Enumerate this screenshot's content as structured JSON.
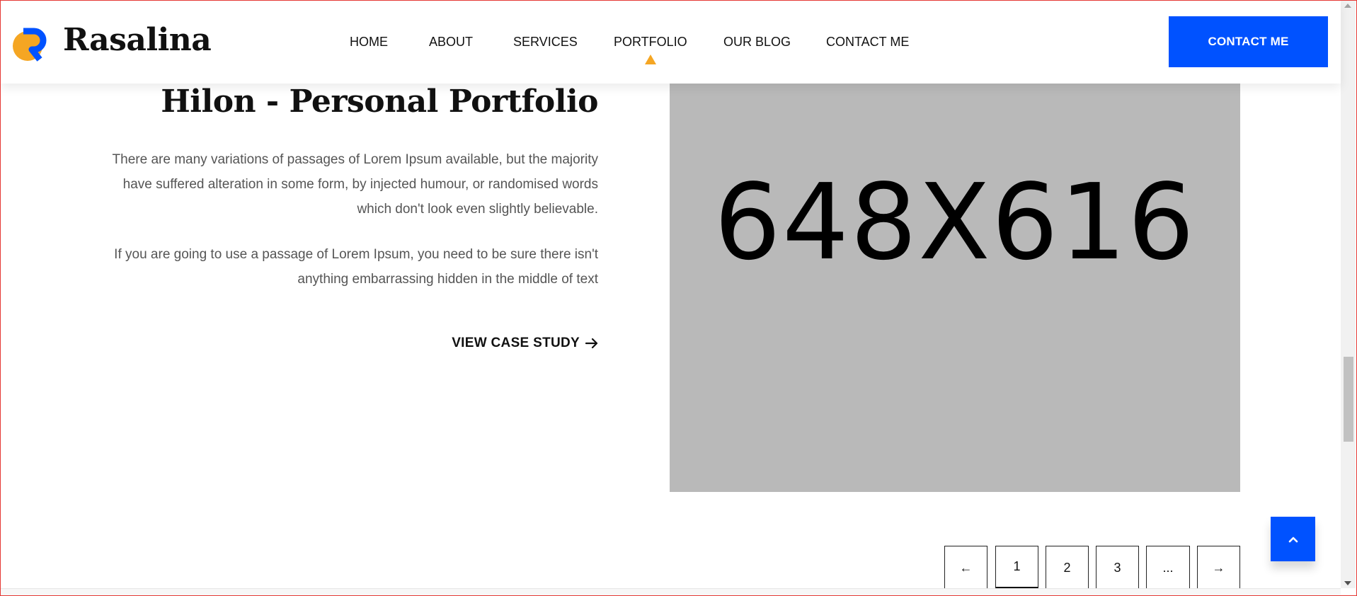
{
  "brand": {
    "name": "Rasalina"
  },
  "nav": {
    "items": [
      {
        "label": "HOME"
      },
      {
        "label": "ABOUT"
      },
      {
        "label": "SERVICES"
      },
      {
        "label": "PORTFOLIO",
        "active": true
      },
      {
        "label": "OUR BLOG"
      },
      {
        "label": "CONTACT ME"
      }
    ],
    "cta_label": "CONTACT ME"
  },
  "portfolio": {
    "title": "Hilon - Personal Portfolio",
    "paragraphs": [
      "There are many variations of passages of Lorem Ipsum available, but the majority have suffered alteration in some form, by injected humour, or randomised words which don't look even slightly believable.",
      "If you are going to use a passage of Lorem Ipsum, you need to be sure there isn't anything embarrassing hidden in the middle of text"
    ],
    "case_study_label": "VIEW CASE STUDY",
    "image_placeholder": "648X616"
  },
  "pagination": {
    "prev_label": "←",
    "pages": [
      "1",
      "2",
      "3",
      "..."
    ],
    "current_page": "1",
    "next_label": "→"
  },
  "colors": {
    "accent": "#0052ff",
    "highlight": "#f5a623",
    "placeholder_bg": "#b9b9b9"
  },
  "icons": {
    "logo": "r-logo-icon",
    "case_arrow": "arrow-right-icon",
    "back_to_top": "chevron-up-icon"
  }
}
